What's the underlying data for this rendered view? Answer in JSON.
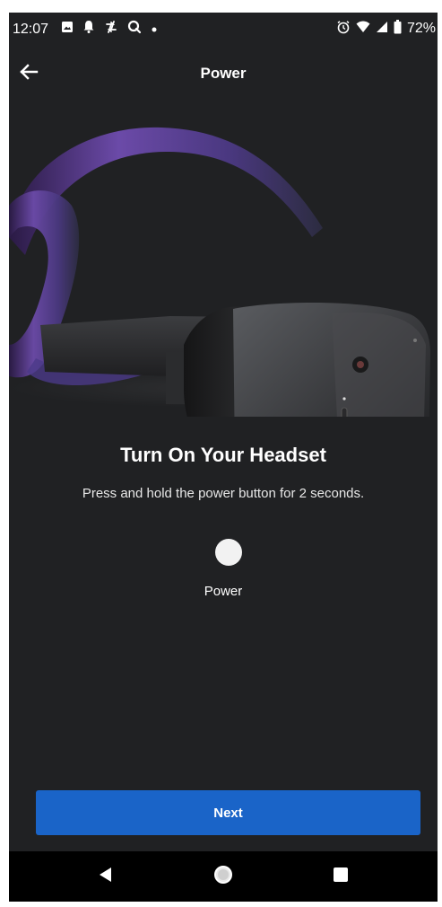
{
  "status_bar": {
    "time": "12:07",
    "battery": "72%",
    "icons_left": [
      "image-icon",
      "notification-icon",
      "sync-icon",
      "search-q-icon",
      "dot-icon"
    ],
    "icons_right": [
      "alarm-icon",
      "wifi-icon",
      "signal-icon",
      "battery-icon"
    ]
  },
  "app_bar": {
    "title": "Power",
    "back_icon": "arrow-left-icon"
  },
  "hero": {
    "image": "vr-headset-image"
  },
  "content": {
    "heading": "Turn On Your Headset",
    "subtext": "Press and hold the power button for 2 seconds.",
    "power_label": "Power"
  },
  "footer": {
    "next_label": "Next",
    "accent_color": "#1a64c8"
  },
  "nav_bar": {
    "items": [
      "back-triangle-icon",
      "home-circle-icon",
      "recents-square-icon"
    ]
  }
}
